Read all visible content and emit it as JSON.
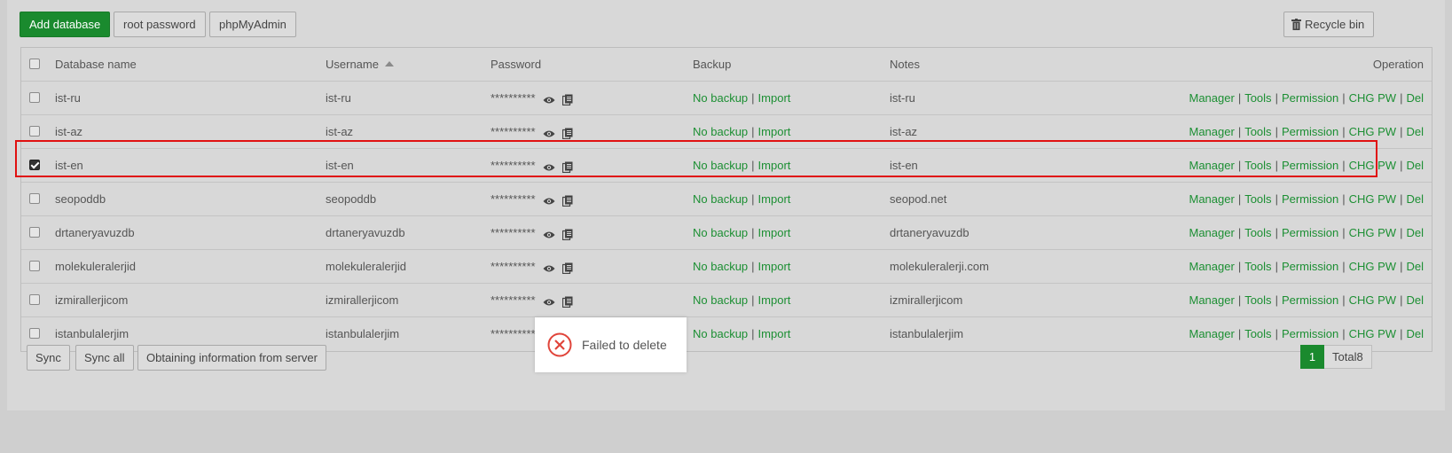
{
  "toolbar": {
    "add_database": "Add database",
    "root_password": "root password",
    "phpmyadmin": "phpMyAdmin",
    "recycle_bin": "Recycle bin"
  },
  "table": {
    "headers": {
      "name": "Database name",
      "username": "Username",
      "password": "Password",
      "backup": "Backup",
      "notes": "Notes",
      "operation": "Operation"
    },
    "rows": [
      {
        "name": "ist-ru",
        "username": "ist-ru",
        "password": "**********",
        "backup": "No backup",
        "import": "Import",
        "notes": "ist-ru",
        "checked": false
      },
      {
        "name": "ist-az",
        "username": "ist-az",
        "password": "**********",
        "backup": "No backup",
        "import": "Import",
        "notes": "ist-az",
        "checked": false
      },
      {
        "name": "ist-en",
        "username": "ist-en",
        "password": "**********",
        "backup": "No backup",
        "import": "Import",
        "notes": "ist-en",
        "checked": true
      },
      {
        "name": "seopoddb",
        "username": "seopoddb",
        "password": "**********",
        "backup": "No backup",
        "import": "Import",
        "notes": "seopod.net",
        "checked": false
      },
      {
        "name": "drtaneryavuzdb",
        "username": "drtaneryavuzdb",
        "password": "**********",
        "backup": "No backup",
        "import": "Import",
        "notes": "drtaneryavuzdb",
        "checked": false
      },
      {
        "name": "molekuleralerjid",
        "username": "molekuleralerjid",
        "password": "**********",
        "backup": "No backup",
        "import": "Import",
        "notes": "molekuleralerji.com",
        "checked": false
      },
      {
        "name": "izmirallerjicom",
        "username": "izmirallerjicom",
        "password": "**********",
        "backup": "No backup",
        "import": "Import",
        "notes": "izmirallerjicom",
        "checked": false
      },
      {
        "name": "istanbulalerjim",
        "username": "istanbulalerjim",
        "password": "**********",
        "backup": "No backup",
        "import": "Import",
        "notes": "istanbulalerjim",
        "checked": false
      }
    ],
    "operations": [
      "Manager",
      "Tools",
      "Permission",
      "CHG PW",
      "Del"
    ]
  },
  "footer": {
    "sync": "Sync",
    "sync_all": "Sync all",
    "obtain": "Obtaining information from server",
    "page": "1",
    "total": "Total8"
  },
  "toast": {
    "message": "Failed to delete",
    "icon": "error-circle-icon"
  },
  "colors": {
    "accent": "#1a8a2e",
    "link": "#1c8f33",
    "highlight": "#e01010",
    "error": "#e0443a"
  }
}
